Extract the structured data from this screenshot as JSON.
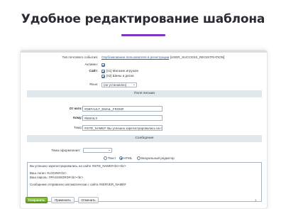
{
  "page": {
    "heading": "Удобное редактирование шаблона"
  },
  "form": {
    "event_type": {
      "label": "Тип почтового события:",
      "link": "Опубликование пользователя в регистрации",
      "code": "[USER_SUCCESS_REGISTRATION]"
    },
    "active": {
      "label": "Активен:"
    },
    "site": {
      "label": "Сайт:",
      "options": [
        "[s1] Магазин игрушек",
        "[s2] Шины и диски"
      ]
    },
    "language": {
      "label": "Язык:",
      "value": "(не установлен)"
    },
    "letter_fields": {
      "section_title": "Поля письма",
      "from": {
        "label": "От кого:",
        "value": "#DEFAULT_EMAIL_FROM#"
      },
      "to": {
        "label": "Кому:",
        "value": "#EMAIL#"
      },
      "subject": {
        "label": "Тема:",
        "value": "#SITE_NAME#: Вы успешно зарегистрировались на сайте"
      }
    },
    "message": {
      "section_title": "Сообщение",
      "design_theme": {
        "label": "Тема оформления:",
        "value": ""
      },
      "format_options": [
        "Текст",
        "HTML",
        "Визуальный редактор"
      ],
      "selected_format": "HTML",
      "body_lines": [
        "Вы успешно зарегистрировались на сайте #SITE_NAME#<br><br>",
        "",
        "Ваш логин: #LOGIN#<br>",
        "Ваш пароль: #PASSWORD#<br><br>",
        "",
        "Сообщение отправлено автоматически с сайта #SERVER_NAME#"
      ]
    },
    "buttons": {
      "save": "Сохранить",
      "apply": "Применить",
      "cancel": "Отменить"
    },
    "help_mark": "1"
  }
}
